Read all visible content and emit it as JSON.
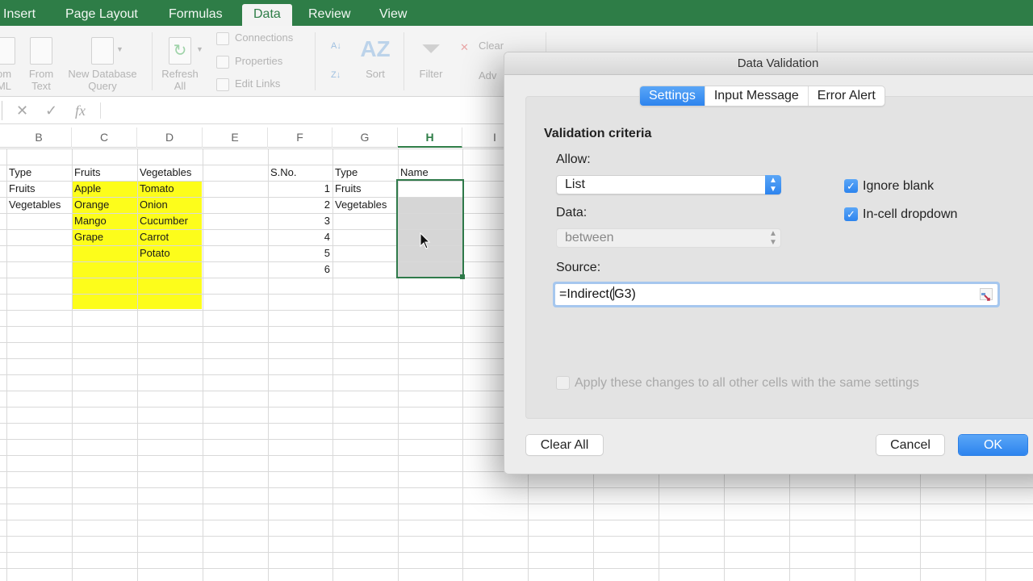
{
  "ribbon_tabs": [
    "Insert",
    "Page Layout",
    "Formulas",
    "Data",
    "Review",
    "View"
  ],
  "active_tab": "Data",
  "ribbon": {
    "from_xml": "om\nML",
    "from_xml_l1": "om",
    "from_xml_l2": "ML",
    "from_text_l1": "From",
    "from_text_l2": "Text",
    "new_db_l1": "New Database",
    "new_db_l2": "Query",
    "refresh_l1": "Refresh",
    "refresh_l2": "All",
    "connections": "Connections",
    "properties": "Properties",
    "edit_links": "Edit Links",
    "sort": "Sort",
    "filter": "Filter",
    "clear": "Clear",
    "advanced": "Adv"
  },
  "formula_bar": {
    "cancel_icon": "✕",
    "enter_icon": "✓",
    "fx_label": "fx",
    "value": ""
  },
  "columns": [
    "B",
    "C",
    "D",
    "E",
    "F",
    "G",
    "H",
    "I"
  ],
  "selected_column": "H",
  "sheet": {
    "B": [
      "Type",
      "Fruits",
      "Vegetables"
    ],
    "C": [
      "Fruits",
      "Apple",
      "Orange",
      "Mango",
      "Grape"
    ],
    "D": [
      "Vegetables",
      "Tomato",
      "Onion",
      "Cucumber",
      "Carrot",
      "Potato"
    ],
    "F": [
      "S.No.",
      "1",
      "2",
      "3",
      "4",
      "5",
      "6"
    ],
    "G": [
      "Type",
      "Fruits",
      "Vegetables"
    ],
    "H": [
      "Name"
    ]
  },
  "highlight_color": "#fdfd1b",
  "accent_color": "#2e7d47",
  "dialog": {
    "title": "Data Validation",
    "tabs": [
      "Settings",
      "Input Message",
      "Error Alert"
    ],
    "active_tab": "Settings",
    "section_title": "Validation criteria",
    "allow_label": "Allow:",
    "allow_value": "List",
    "data_label": "Data:",
    "data_value": "between",
    "ignore_blank_label": "Ignore blank",
    "ignore_blank_checked": true,
    "in_cell_dropdown_label": "In-cell dropdown",
    "in_cell_dropdown_checked": true,
    "source_label": "Source:",
    "source_value_before_caret": "=Indirect(",
    "source_value_after_caret": "G3)",
    "apply_all_label": "Apply these changes to all other cells with the same settings",
    "apply_all_checked": false,
    "clear_all": "Clear All",
    "cancel": "Cancel",
    "ok": "OK"
  }
}
